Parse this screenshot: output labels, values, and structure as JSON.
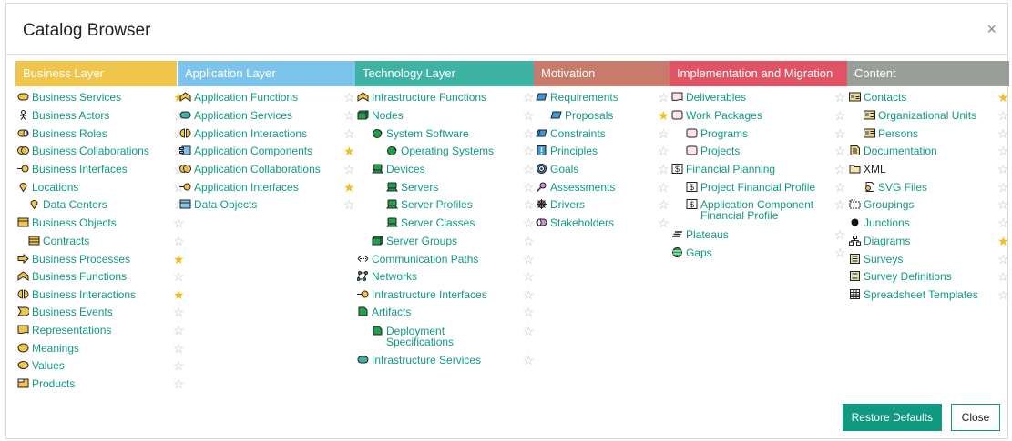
{
  "dialog": {
    "title": "Catalog Browser",
    "close_glyph": "×",
    "restore_label": "Restore Defaults",
    "close_label": "Close"
  },
  "colors": {
    "accent": "#0f9a82",
    "star_on": "#f2bd21",
    "star_off": "#bdbdbd"
  },
  "columns": [
    {
      "id": "business",
      "title": "Business Layer",
      "color": "#f0c54b",
      "items": [
        {
          "label": "Business Services",
          "icon": "business-service-icon",
          "starred": true
        },
        {
          "label": "Business Actors",
          "icon": "actor-icon",
          "starred": false
        },
        {
          "label": "Business Roles",
          "icon": "role-icon",
          "starred": false
        },
        {
          "label": "Business Collaborations",
          "icon": "collaboration-icon",
          "starred": false
        },
        {
          "label": "Business Interfaces",
          "icon": "interface-icon",
          "starred": false
        },
        {
          "label": "Locations",
          "icon": "location-icon",
          "starred": false
        },
        {
          "label": "Data Centers",
          "icon": "location-icon",
          "starred": false
        },
        {
          "label": "Business Objects",
          "icon": "object-icon",
          "starred": false
        },
        {
          "label": "Contracts",
          "icon": "contract-icon",
          "starred": false
        },
        {
          "label": "Business Processes",
          "icon": "process-icon",
          "starred": true
        },
        {
          "label": "Business Functions",
          "icon": "function-icon",
          "starred": false
        },
        {
          "label": "Business Interactions",
          "icon": "interaction-icon",
          "starred": true
        },
        {
          "label": "Business Events",
          "icon": "event-icon",
          "starred": false
        },
        {
          "label": "Representations",
          "icon": "representation-icon",
          "starred": false
        },
        {
          "label": "Meanings",
          "icon": "meaning-icon",
          "starred": false
        },
        {
          "label": "Values",
          "icon": "value-icon",
          "starred": false
        },
        {
          "label": "Products",
          "icon": "product-icon",
          "starred": false
        }
      ]
    },
    {
      "id": "application",
      "title": "Application Layer",
      "color": "#7dc4ec",
      "items": [
        {
          "label": "Application Functions",
          "icon": "function-icon",
          "starred": false
        },
        {
          "label": "Application Services",
          "icon": "service-icon",
          "starred": false
        },
        {
          "label": "Application Interactions",
          "icon": "interaction-icon",
          "starred": false
        },
        {
          "label": "Application Components",
          "icon": "component-icon",
          "starred": true
        },
        {
          "label": "Application Collaborations",
          "icon": "collaboration-icon",
          "starred": false
        },
        {
          "label": "Application Interfaces",
          "icon": "interface-icon",
          "starred": true
        },
        {
          "label": "Data Objects",
          "icon": "data-object-icon",
          "starred": false
        }
      ]
    },
    {
      "id": "technology",
      "title": "Technology Layer",
      "color": "#3fb3a3",
      "items": [
        {
          "label": "Infrastructure Functions",
          "icon": "function-icon",
          "starred": false
        },
        {
          "label": "Nodes",
          "icon": "node-icon",
          "starred": false
        },
        {
          "label": "System Software",
          "icon": "system-software-icon",
          "starred": false
        },
        {
          "label": "Operating Systems",
          "icon": "system-software-icon",
          "starred": false
        },
        {
          "label": "Devices",
          "icon": "device-icon",
          "starred": false
        },
        {
          "label": "Servers",
          "icon": "device-icon",
          "starred": false
        },
        {
          "label": "Server Profiles",
          "icon": "device-icon",
          "starred": false
        },
        {
          "label": "Server Classes",
          "icon": "device-icon",
          "starred": false
        },
        {
          "label": "Server Groups",
          "icon": "node-icon",
          "starred": false
        },
        {
          "label": "Communication Paths",
          "icon": "path-icon",
          "starred": false
        },
        {
          "label": "Networks",
          "icon": "network-icon",
          "starred": false
        },
        {
          "label": "Infrastructure Interfaces",
          "icon": "interface-icon",
          "starred": false
        },
        {
          "label": "Artifacts",
          "icon": "artifact-icon",
          "starred": false
        },
        {
          "label": "Deployment\nSpecifications",
          "icon": "artifact-icon",
          "starred": false
        },
        {
          "label": "Infrastructure Services",
          "icon": "service-icon",
          "starred": false
        }
      ]
    },
    {
      "id": "motivation",
      "title": "Motivation",
      "color": "#c97b6b",
      "items": [
        {
          "label": "Requirements",
          "icon": "requirement-icon",
          "starred": false
        },
        {
          "label": "Proposals",
          "icon": "requirement-icon",
          "starred": true
        },
        {
          "label": "Constraints",
          "icon": "constraint-icon",
          "starred": false
        },
        {
          "label": "Principles",
          "icon": "principle-icon",
          "starred": false
        },
        {
          "label": "Goals",
          "icon": "goal-icon",
          "starred": false
        },
        {
          "label": "Assessments",
          "icon": "assessment-icon",
          "starred": false
        },
        {
          "label": "Drivers",
          "icon": "driver-icon",
          "starred": false
        },
        {
          "label": "Stakeholders",
          "icon": "stakeholder-icon",
          "starred": false
        }
      ]
    },
    {
      "id": "implementation",
      "title": "Implementation and Migration",
      "color": "#e05466",
      "items": [
        {
          "label": "Deliverables",
          "icon": "deliverable-icon",
          "starred": false
        },
        {
          "label": "Work Packages",
          "icon": "work-package-icon",
          "starred": false
        },
        {
          "label": "Programs",
          "icon": "work-package-icon",
          "starred": false
        },
        {
          "label": "Projects",
          "icon": "work-package-icon",
          "starred": false
        },
        {
          "label": "Financial Planning",
          "icon": "financial-icon",
          "starred": false
        },
        {
          "label": "Project Financial Profile",
          "icon": "financial-icon",
          "starred": false
        },
        {
          "label": "Application Component\nFinancial Profile",
          "icon": "financial-icon",
          "starred": false
        },
        {
          "label": "Plateaus",
          "icon": "plateau-icon",
          "starred": false
        },
        {
          "label": "Gaps",
          "icon": "gap-icon",
          "starred": false
        }
      ]
    },
    {
      "id": "content",
      "title": "Content",
      "color": "#9a9e99",
      "items": [
        {
          "label": "Contacts",
          "icon": "contacts-icon",
          "starred": true
        },
        {
          "label": "Organizational Units",
          "icon": "contacts-icon",
          "starred": false
        },
        {
          "label": "Persons",
          "icon": "contacts-icon",
          "starred": false
        },
        {
          "label": "Documentation",
          "icon": "documentation-icon",
          "starred": false
        },
        {
          "label": "XML",
          "icon": "folder-icon",
          "starred": false
        },
        {
          "label": "SVG Files",
          "icon": "svg-file-icon",
          "starred": false
        },
        {
          "label": "Groupings",
          "icon": "grouping-icon",
          "starred": false
        },
        {
          "label": "Junctions",
          "icon": "junction-icon",
          "starred": false
        },
        {
          "label": "Diagrams",
          "icon": "diagram-icon",
          "starred": true
        },
        {
          "label": "Surveys",
          "icon": "survey-icon",
          "starred": false
        },
        {
          "label": "Survey Definitions",
          "icon": "survey-icon",
          "starred": false
        },
        {
          "label": "Spreadsheet Templates",
          "icon": "spreadsheet-icon",
          "starred": false
        }
      ]
    }
  ]
}
